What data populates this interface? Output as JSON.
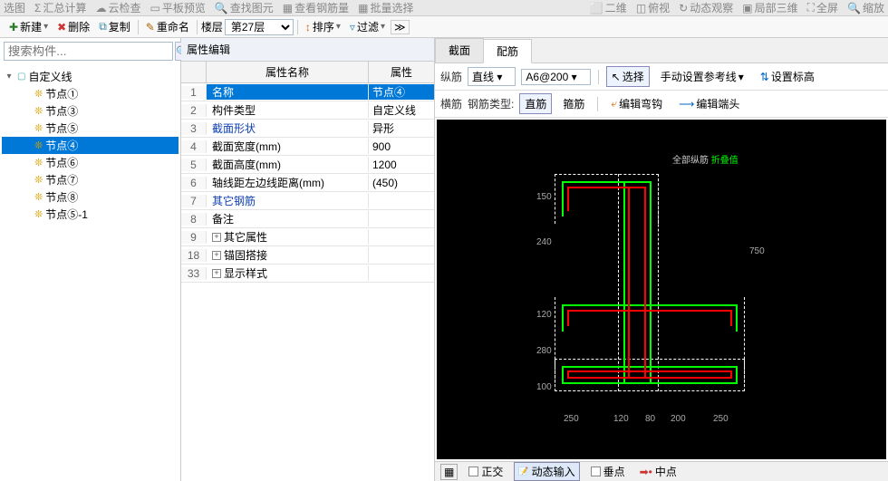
{
  "top_menu": {
    "items": [
      "选图",
      "汇总计算",
      "云检查",
      "平板预览",
      "查找图元",
      "查看钢筋量",
      "批量选择",
      "二维",
      "俯视",
      "动态观察",
      "局部三维",
      "全屏",
      "缩放"
    ]
  },
  "toolbar": {
    "new_label": "新建",
    "delete_label": "删除",
    "copy_label": "复制",
    "rename_label": "重命名",
    "floor_label": "楼层",
    "floor_value": "第27层",
    "sort_label": "排序",
    "filter_label": "过滤"
  },
  "search": {
    "placeholder": "搜索构件..."
  },
  "tree": {
    "root_label": "自定义线",
    "items": [
      {
        "label": "节点①",
        "selected": false
      },
      {
        "label": "节点③",
        "selected": false
      },
      {
        "label": "节点⑤",
        "selected": false
      },
      {
        "label": "节点④",
        "selected": true
      },
      {
        "label": "节点⑥",
        "selected": false
      },
      {
        "label": "节点⑦",
        "selected": false
      },
      {
        "label": "节点⑧",
        "selected": false
      },
      {
        "label": "节点⑤-1",
        "selected": false
      }
    ]
  },
  "mid": {
    "title": "属性编辑",
    "col_num": "",
    "col_name": "属性名称",
    "col_val": "属性",
    "rows": [
      {
        "n": "1",
        "name": "名称",
        "val": "节点④",
        "sel": true
      },
      {
        "n": "2",
        "name": "构件类型",
        "val": "自定义线"
      },
      {
        "n": "3",
        "name": "截面形状",
        "val": "异形",
        "blue": true
      },
      {
        "n": "4",
        "name": "截面宽度(mm)",
        "val": "900"
      },
      {
        "n": "5",
        "name": "截面高度(mm)",
        "val": "1200"
      },
      {
        "n": "6",
        "name": "轴线距左边线距离(mm)",
        "val": "(450)"
      },
      {
        "n": "7",
        "name": "其它钢筋",
        "val": "",
        "blue": true
      },
      {
        "n": "8",
        "name": "备注",
        "val": ""
      },
      {
        "n": "9",
        "name": "其它属性",
        "val": "",
        "exp": true
      },
      {
        "n": "18",
        "name": "锚固搭接",
        "val": "",
        "exp": true
      },
      {
        "n": "33",
        "name": "显示样式",
        "val": "",
        "exp": true
      }
    ]
  },
  "right": {
    "tabs": [
      {
        "label": "截面",
        "active": false
      },
      {
        "label": "配筋",
        "active": true
      }
    ],
    "row1": {
      "zongjin": "纵筋",
      "shape": "直线",
      "spec": "A6@200",
      "select": "选择",
      "manual": "手动设置参考线",
      "elev": "设置标高"
    },
    "row2": {
      "hengjin": "横筋",
      "type_label": "钢筋类型:",
      "zhijin": "直筋",
      "gujin": "箍筋",
      "hook": "编辑弯钩",
      "end": "编辑端头"
    },
    "annot1": "全部纵筋",
    "annot2": "折叠值",
    "dims": [
      "150",
      "240",
      "750",
      "120",
      "280",
      "100",
      "250",
      "120",
      "80",
      "200",
      "250"
    ]
  },
  "status": {
    "ortho": "正交",
    "dynamic": "动态输入",
    "perp": "垂点",
    "mid": "中点"
  }
}
